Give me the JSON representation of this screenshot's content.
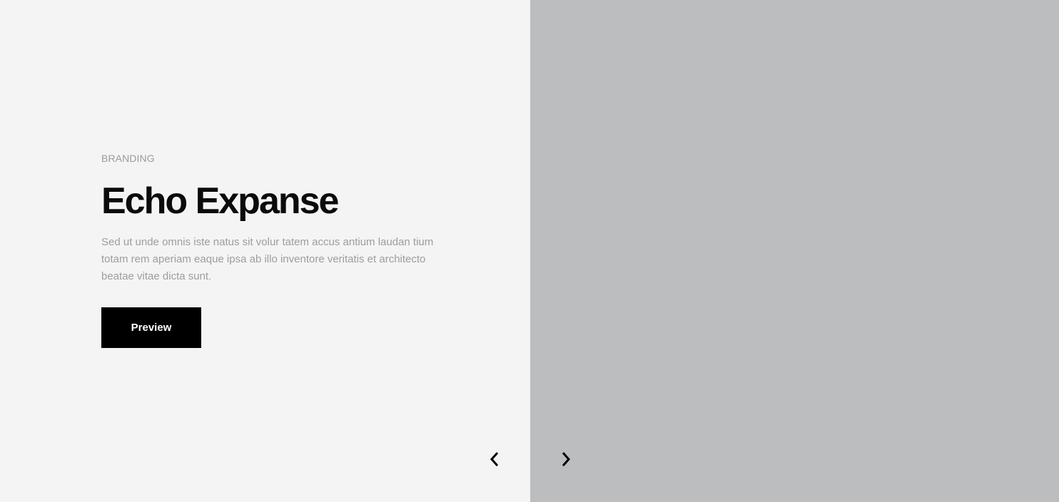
{
  "slide": {
    "category": "BRANDING",
    "title": "Echo Expanse",
    "description": "Sed ut unde omnis iste natus sit volur tatem accus antium laudan tium totam rem aperiam eaque ipsa ab illo inventore veritatis et architecto beatae vitae dicta sunt.",
    "button_label": "Preview"
  },
  "navigation": {
    "prev_icon": "chevron-left-icon",
    "next_icon": "chevron-right-icon"
  },
  "colors": {
    "left_background": "#f4f4f4",
    "right_background": "#bcbdbf",
    "button_background": "#000000",
    "title_color": "#0b0b0b",
    "muted_text": "#9d9d9d"
  }
}
